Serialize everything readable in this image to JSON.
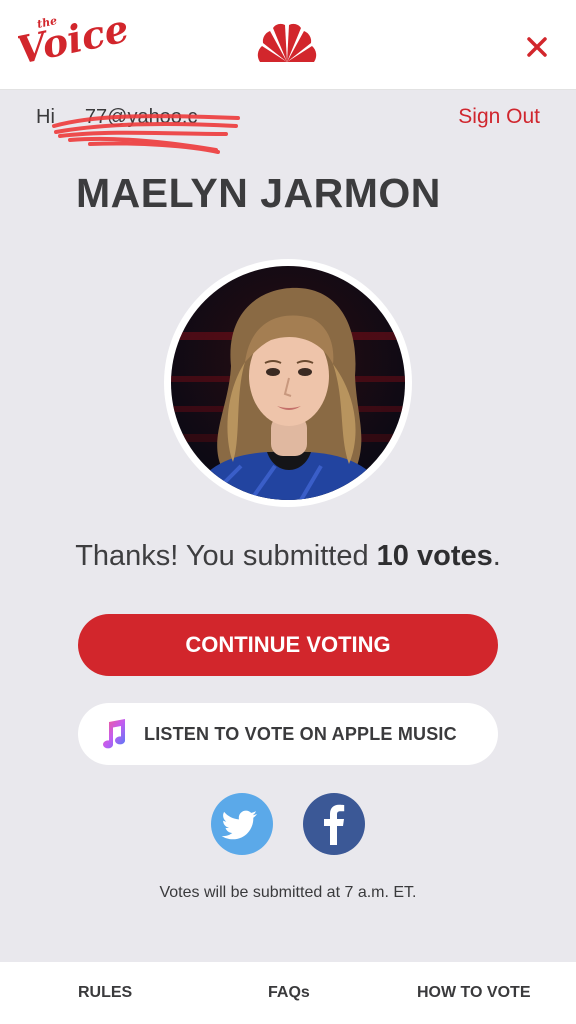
{
  "header": {
    "logo_small": "the",
    "logo_text": "Voice"
  },
  "account": {
    "greeting": "Hi",
    "redacted_email": "77@yahoo.c",
    "sign_out": "Sign Out"
  },
  "artist": {
    "name": "MAELYN JARMON"
  },
  "confirmation": {
    "prefix": "Thanks! You submitted ",
    "votes": "10 votes",
    "suffix": "."
  },
  "actions": {
    "continue_label": "CONTINUE VOTING",
    "apple_music_label": "LISTEN TO VOTE ON APPLE MUSIC"
  },
  "social": {
    "twitter_icon": "twitter-icon",
    "facebook_icon": "facebook-icon"
  },
  "note": "Votes will be submitted at 7 a.m. ET.",
  "footer": {
    "rules": "RULES",
    "faqs": "FAQs",
    "how_to_vote": "HOW TO VOTE"
  },
  "colors": {
    "accent": "#d2262c",
    "background": "#e9e8ed",
    "twitter": "#5ba9e9",
    "facebook": "#3b5896"
  }
}
